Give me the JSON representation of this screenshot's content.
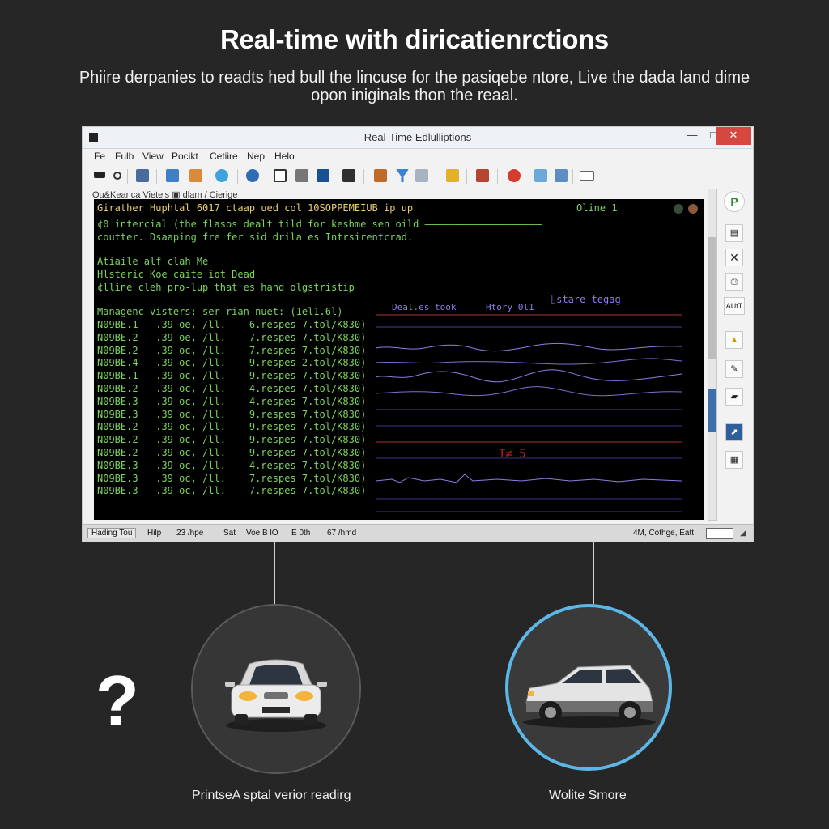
{
  "header": {
    "title": "Real-time with diricatienrctions",
    "subtitle_line1": "Phiire derpanies to readts hed bull the lincuse for the pasiqebe ntore, Live the dada land dime",
    "subtitle_line2": "opon iniginals thon the reaal."
  },
  "window": {
    "title": "Real-Time Edlulliptions",
    "controls": {
      "minimize": "—",
      "maximize": "□",
      "close": "✕"
    },
    "menu": [
      "Fe",
      "Fulb",
      "View",
      "Pocikt",
      "Cetiire",
      "Nep",
      "Helo"
    ],
    "panel_header": "Ou&Kearica Vietels  ▣ dlam / Cierige",
    "console": {
      "header_line": "Girather Huphtal 6017 ctaap ued col 10SOPPEMEIUB ip up",
      "online_label": "Oline 1",
      "info_lines": [
        "¢0 intercial (the flasos dealt tild for keshme sen oild ————————————————————",
        "coutter. Dsaaping fre fer sid drila es Intrsirentcrad."
      ],
      "note_lines": [
        "Atiaile alf clah Me",
        "Hlsteric Koe caite iot Dead",
        "¢lline cleh pro-lup that es hand olgstristip"
      ],
      "log_header": "Managenc_visters: ser_rian_nuet: (1el1.6l)",
      "log_rows": [
        "N09BE.1   .39 oe, /ll.    6.respes 7.tol/K830)",
        "N09BE.2   .39 oe, /ll.    7.respes 7.tol/K830)",
        "N09BE.2   .39 oc, /ll.    7.respes 7.tol/K830)",
        "N09BE.4   .39 oc, /ll.    9.respes 2.tol/K830)",
        "N09BE.1   .39 oc, /ll.    9.respes 7.tol/K830)",
        "N09BE.2   .39 oc, /ll.    4.respes 7.tol/K830)",
        "N09BE.3   .39 oc, /ll.    4.respes 7.tol/K830)",
        "N09BE.3   .39 oc, /ll.    9.respes 7.tol/K830)",
        "N09BE.2   .39 oc, /ll.    9.respes 7.tol/K830)",
        "N09BE.2   .39 oc, /ll.    9.respes 7.tol/K830)",
        "N09BE.2   .39 oc, /ll.    9.respes 7.tol/K830)",
        "N09BE.3   .39 oc, /ll.    4.respes 7.tol/K830)",
        "N09BE.3   .39 oc, /ll.    7.respes 7.tol/K830)",
        "N09BE.3   .39 oc, /ll.    7.respes 7.tol/K830)"
      ],
      "graph_labels": {
        "deal": "Deal.es took",
        "history": "Htory 0l1",
        "distance": "⌷stare tegag",
        "marker": "T≠ 5"
      }
    },
    "right_toolbar": {
      "buttons": [
        "AUtT"
      ]
    },
    "status": [
      "Hading Tou",
      "Hilp",
      "23 /hpe",
      "Sat",
      "Voe B lO",
      "E 0th",
      "67 /hmd",
      "4M, Cothge, Eatt"
    ]
  },
  "panels": {
    "left_caption": "PrintseA sptal verior readirg",
    "right_caption": "Wolite Smore",
    "question_mark": "?"
  },
  "colors": {
    "console_bg": "#000000",
    "console_green": "#7cd45c",
    "console_yellow": "#e8d070",
    "graph_purple": "#8e7de8",
    "accent_red": "#b6242a",
    "circle_ring_blue": "#5cb6e6"
  }
}
